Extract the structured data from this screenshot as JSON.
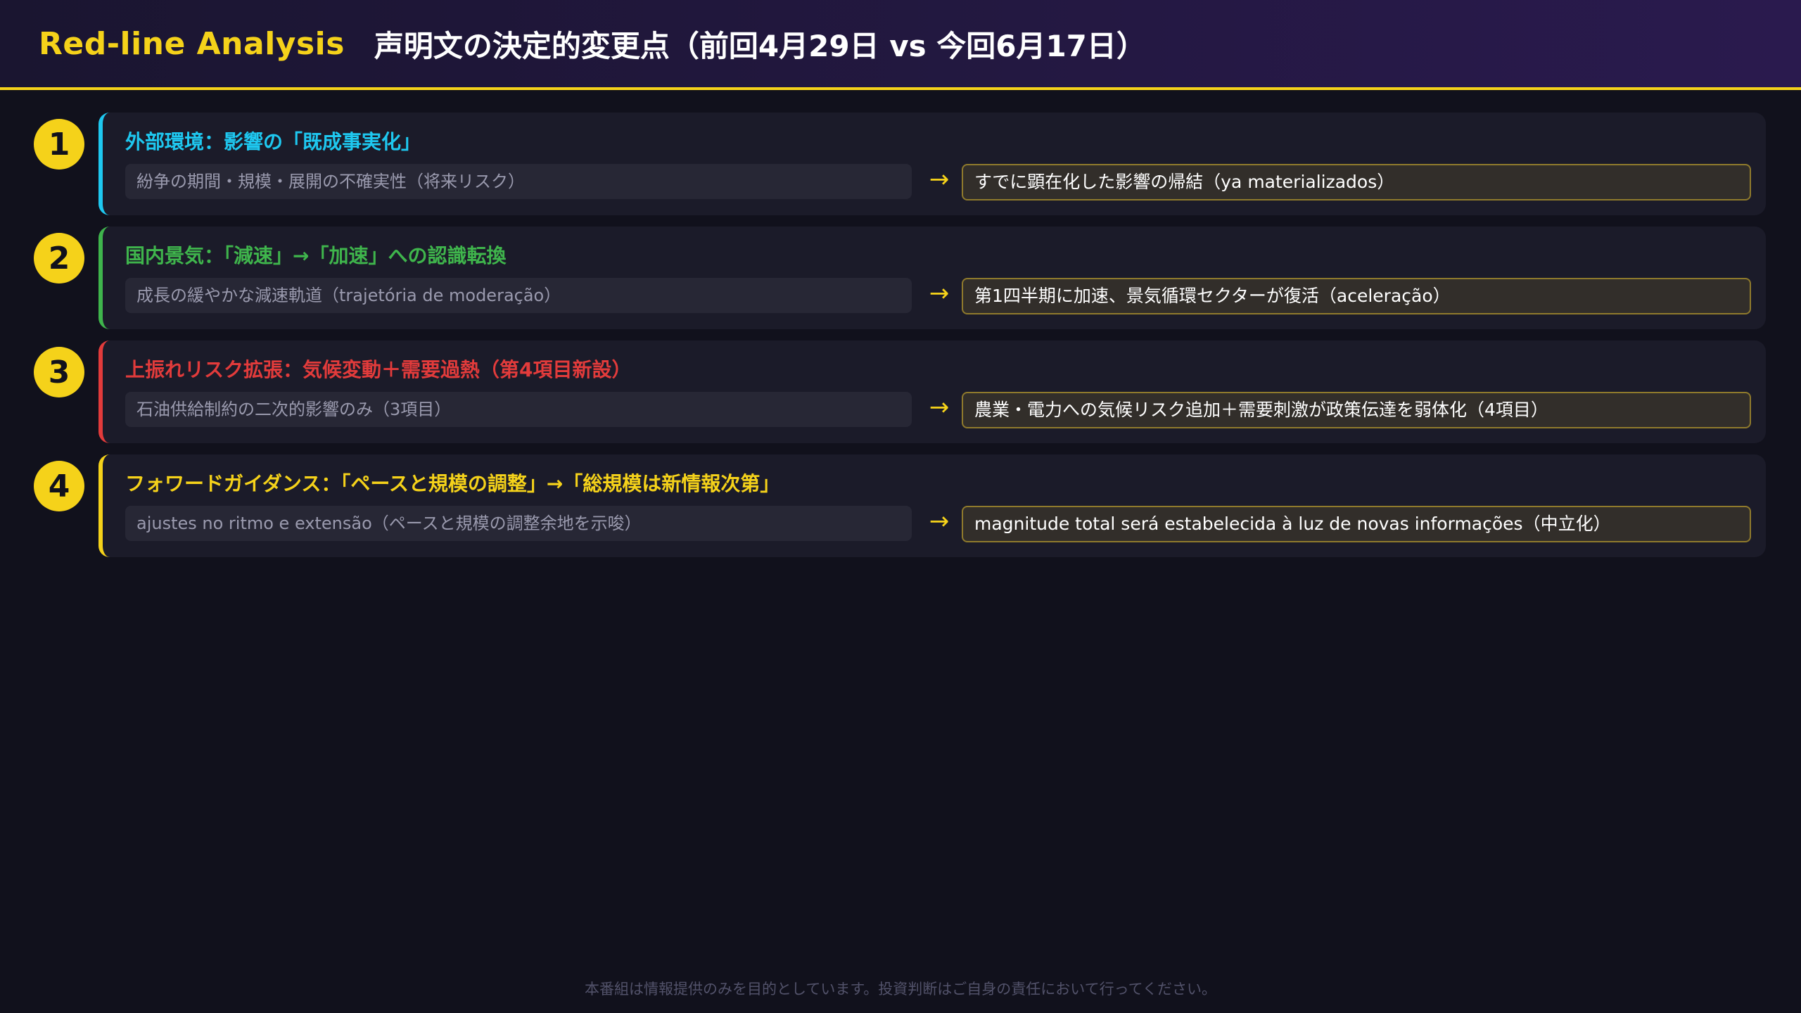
{
  "header": {
    "brand": "Red-line Analysis",
    "title": "声明文の決定的変更点（前回4月29日 vs 今回6月17日）"
  },
  "colors": {
    "brand_yellow": "#f5d21a",
    "cyan": "#1ec8f0",
    "green": "#3fb54c",
    "red": "#e23b3b",
    "yellow": "#f5d21a"
  },
  "rows": [
    {
      "number": "1",
      "heading": "外部環境：影響の「既成事実化」",
      "before": "紛争の期間・規模・展開の不確実性（将来リスク）",
      "arrow": "→",
      "after": "すでに顕在化した影響の帰結（ya materializados）"
    },
    {
      "number": "2",
      "heading": "国内景気：「減速」→「加速」への認識転換",
      "before": "成長の緩やかな減速軌道（trajetória de moderação）",
      "arrow": "→",
      "after": "第1四半期に加速、景気循環セクターが復活（aceleração）"
    },
    {
      "number": "3",
      "heading": "上振れリスク拡張：気候変動＋需要過熱（第4項目新設）",
      "before": "石油供給制約の二次的影響のみ（3項目）",
      "arrow": "→",
      "after": "農業・電力への気候リスク追加＋需要刺激が政策伝達を弱体化（4項目）"
    },
    {
      "number": "4",
      "heading": "フォワードガイダンス：「ペースと規模の調整」→「総規模は新情報次第」",
      "before": "ajustes no ritmo e extensão（ペースと規模の調整余地を示唆）",
      "arrow": "→",
      "after": "magnitude total será estabelecida à luz de novas informações（中立化）"
    }
  ],
  "footer": {
    "disclaimer": "本番組は情報提供のみを目的としています。投資判断はご自身の責任において行ってください。"
  }
}
